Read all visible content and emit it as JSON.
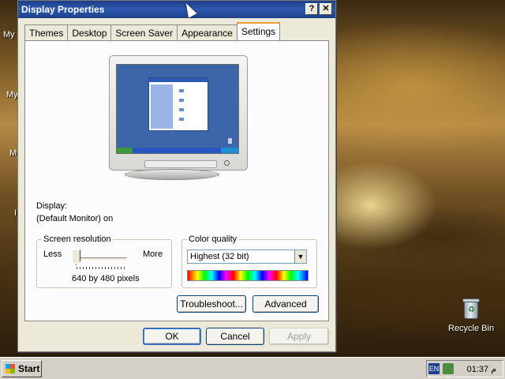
{
  "desktop": {
    "left_labels": [
      "My",
      "My",
      "My",
      "I"
    ],
    "recycle_bin_label": "Recycle Bin"
  },
  "dialog": {
    "title": "Display Properties",
    "help_button": "?",
    "close_button": "✕",
    "tabs": [
      "Themes",
      "Desktop",
      "Screen Saver",
      "Appearance",
      "Settings"
    ],
    "active_tab": "Settings",
    "display_label": "Display:",
    "display_value": "(Default Monitor) on",
    "screen_resolution": {
      "legend": "Screen resolution",
      "less_label": "Less",
      "more_label": "More",
      "value_text": "640 by 480 pixels",
      "slider_level": 0
    },
    "color_quality": {
      "legend": "Color quality",
      "selected": "Highest (32 bit)"
    },
    "buttons": {
      "troubleshoot": "Troubleshoot...",
      "advanced": "Advanced",
      "ok": "OK",
      "cancel": "Cancel",
      "apply": "Apply"
    }
  },
  "taskbar": {
    "start_label": "Start",
    "language": "EN",
    "clock": "01:37 م"
  }
}
